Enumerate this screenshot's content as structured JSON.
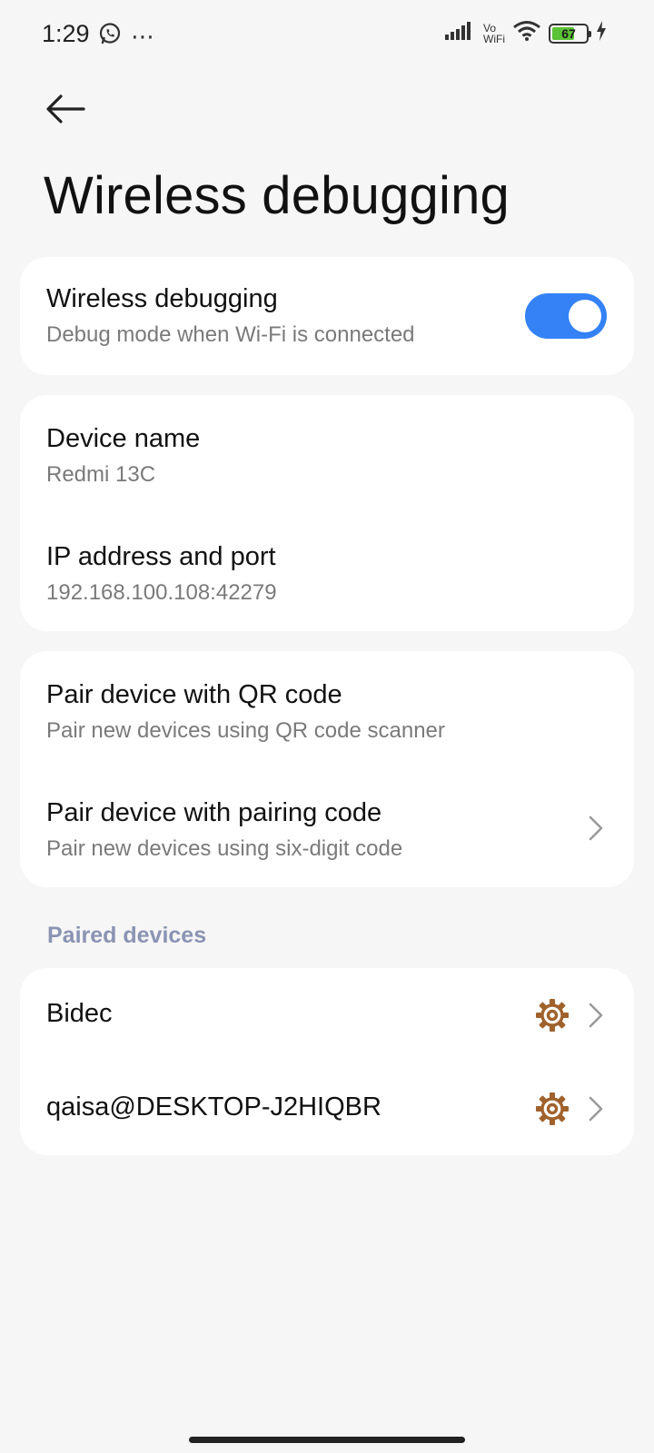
{
  "status_bar": {
    "time": "1:29",
    "left_icons": [
      "whatsapp-icon",
      "more-dots-icon"
    ],
    "more_dots": "⋯",
    "vowifi_top": "Vo",
    "vowifi_bottom": "WiFi",
    "battery_level": "67",
    "battery_fraction": 0.67,
    "charging": true
  },
  "header": {
    "back_icon": "back-arrow-icon",
    "title": "Wireless debugging"
  },
  "toggle_card": {
    "title": "Wireless debugging",
    "subtitle": "Debug mode when Wi-Fi is connected",
    "enabled": true,
    "accent_color": "#3482f6"
  },
  "info_card": {
    "device_name_title": "Device name",
    "device_name_value": "Redmi 13C",
    "ip_title": "IP address and port",
    "ip_value": "192.168.100.108:42279"
  },
  "pair_card": {
    "qr_title": "Pair device with QR code",
    "qr_subtitle": "Pair new devices using QR code scanner",
    "code_title": "Pair device with pairing code",
    "code_subtitle": "Pair new devices using six-digit code"
  },
  "paired_devices": {
    "header": "Paired devices",
    "header_color": "#8a93b3",
    "gear_color": "#a0622d",
    "items": [
      {
        "name": "Bidec"
      },
      {
        "name": "qaisa@DESKTOP-J2HIQBR"
      }
    ]
  }
}
